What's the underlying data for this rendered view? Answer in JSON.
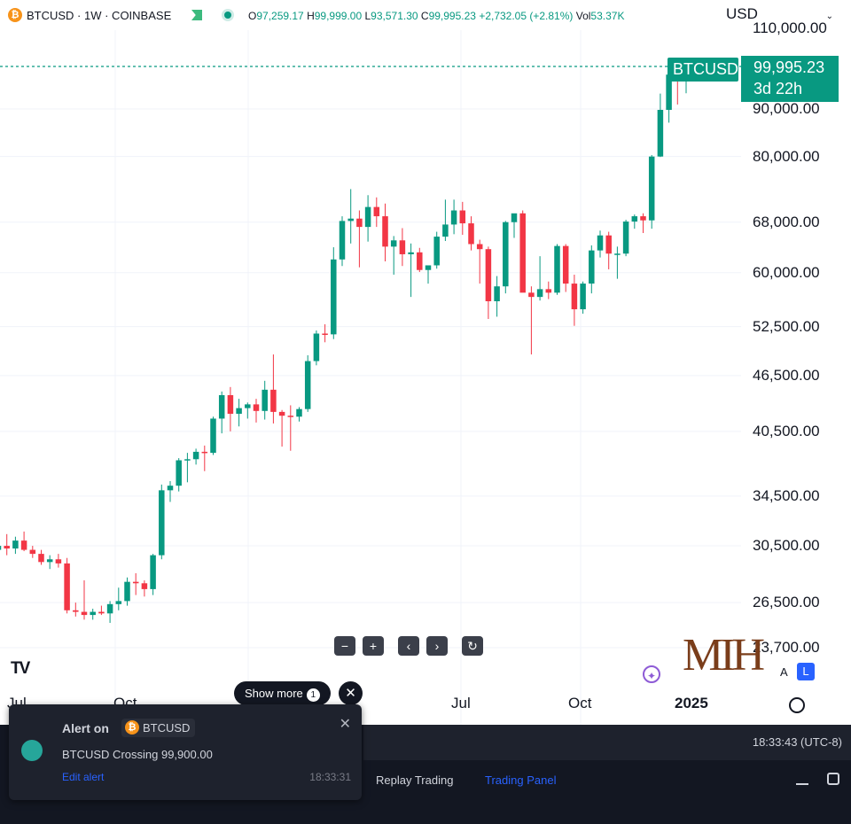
{
  "header": {
    "symbol_line": "BTCUSD · 1W · COINBASE",
    "ohlc": {
      "o_label": "O",
      "o": "97,259.17",
      "h_label": "H",
      "h": "99,999.00",
      "l_label": "L",
      "l": "93,571.30",
      "c_label": "C",
      "c": "99,995.23",
      "change": "+2,732.05 (+2.81%)",
      "vol_label": "Vol",
      "vol": "53.37K"
    },
    "currency": "USD"
  },
  "price_tag": {
    "symbol": "BTCUSD",
    "price": "99,995.23",
    "countdown": "3d 22h"
  },
  "controls": {
    "show_more": "Show more",
    "show_more_count": "1",
    "auto_label": "A",
    "log_label": "L"
  },
  "watermark": "MIH",
  "bottom": {
    "time": "18:33:43 (UTC-8)",
    "tab_replay": "Replay Trading",
    "tab_trading_panel": "Trading Panel"
  },
  "alert": {
    "title": "Alert on",
    "symbol": "BTCUSD",
    "message": "BTCUSD Crossing 99,900.00",
    "edit": "Edit alert",
    "time": "18:33:31"
  },
  "colors": {
    "up": "#089981",
    "down": "#f23645",
    "accent": "#2962ff"
  },
  "chart_data": {
    "type": "candlestick",
    "symbol": "BTCUSD",
    "interval": "1W",
    "y_ticks": [
      "23,700.00",
      "26,500.00",
      "30,500.00",
      "34,500.00",
      "40,500.00",
      "46,500.00",
      "52,500.00",
      "60,000.00",
      "68,000.00",
      "80,000.00",
      "90,000.00",
      "110,000.00"
    ],
    "y_tick_values": [
      23700,
      26500,
      30500,
      34500,
      40500,
      46500,
      52500,
      60000,
      68000,
      80000,
      90000,
      110000
    ],
    "x_ticks": [
      "Jul",
      "Oct",
      "Jul",
      "Oct",
      "2025"
    ],
    "y_scale": "log",
    "last_price": 99995.23,
    "candles": [
      {
        "o": 30200,
        "h": 31800,
        "l": 29800,
        "c": 30500
      },
      {
        "o": 30500,
        "h": 31400,
        "l": 29800,
        "c": 30300
      },
      {
        "o": 30300,
        "h": 31200,
        "l": 29900,
        "c": 30900
      },
      {
        "o": 30900,
        "h": 31600,
        "l": 30100,
        "c": 30200
      },
      {
        "o": 30200,
        "h": 30500,
        "l": 29600,
        "c": 29900
      },
      {
        "o": 29900,
        "h": 30200,
        "l": 29100,
        "c": 29300
      },
      {
        "o": 29300,
        "h": 29800,
        "l": 28800,
        "c": 29500
      },
      {
        "o": 29500,
        "h": 29900,
        "l": 28900,
        "c": 29200
      },
      {
        "o": 29200,
        "h": 29600,
        "l": 25800,
        "c": 26000
      },
      {
        "o": 26000,
        "h": 26500,
        "l": 25600,
        "c": 25900
      },
      {
        "o": 25900,
        "h": 28000,
        "l": 25400,
        "c": 25700
      },
      {
        "o": 25700,
        "h": 26100,
        "l": 25400,
        "c": 25900
      },
      {
        "o": 25900,
        "h": 26300,
        "l": 25700,
        "c": 25800
      },
      {
        "o": 25800,
        "h": 26600,
        "l": 25200,
        "c": 26400
      },
      {
        "o": 26400,
        "h": 27500,
        "l": 26000,
        "c": 26600
      },
      {
        "o": 26600,
        "h": 28200,
        "l": 26300,
        "c": 27900
      },
      {
        "o": 27900,
        "h": 28500,
        "l": 27000,
        "c": 27800
      },
      {
        "o": 27800,
        "h": 28000,
        "l": 26900,
        "c": 27400
      },
      {
        "o": 27400,
        "h": 29900,
        "l": 27000,
        "c": 29800
      },
      {
        "o": 29800,
        "h": 35500,
        "l": 29500,
        "c": 35000
      },
      {
        "o": 35000,
        "h": 35800,
        "l": 34000,
        "c": 35400
      },
      {
        "o": 35400,
        "h": 37900,
        "l": 34900,
        "c": 37700
      },
      {
        "o": 37700,
        "h": 38400,
        "l": 35700,
        "c": 37800
      },
      {
        "o": 37800,
        "h": 38800,
        "l": 37300,
        "c": 38500
      },
      {
        "o": 38500,
        "h": 39100,
        "l": 36700,
        "c": 38400
      },
      {
        "o": 38400,
        "h": 42000,
        "l": 38200,
        "c": 41800
      },
      {
        "o": 41800,
        "h": 44700,
        "l": 40300,
        "c": 44300
      },
      {
        "o": 44300,
        "h": 45200,
        "l": 40500,
        "c": 42300
      },
      {
        "o": 42300,
        "h": 43900,
        "l": 41000,
        "c": 42900
      },
      {
        "o": 42900,
        "h": 43500,
        "l": 41800,
        "c": 43300
      },
      {
        "o": 43300,
        "h": 43900,
        "l": 41400,
        "c": 42600
      },
      {
        "o": 42600,
        "h": 45900,
        "l": 41700,
        "c": 44900
      },
      {
        "o": 44900,
        "h": 49000,
        "l": 41300,
        "c": 42500
      },
      {
        "o": 42500,
        "h": 42700,
        "l": 39000,
        "c": 42100
      },
      {
        "o": 42100,
        "h": 43200,
        "l": 38600,
        "c": 42000
      },
      {
        "o": 42000,
        "h": 43000,
        "l": 41500,
        "c": 42800
      },
      {
        "o": 42800,
        "h": 48900,
        "l": 42500,
        "c": 48200
      },
      {
        "o": 48200,
        "h": 52000,
        "l": 47700,
        "c": 51600
      },
      {
        "o": 51600,
        "h": 52800,
        "l": 50500,
        "c": 51500
      },
      {
        "o": 51500,
        "h": 63900,
        "l": 50900,
        "c": 62000
      },
      {
        "o": 62000,
        "h": 69000,
        "l": 61000,
        "c": 68200
      },
      {
        "o": 68200,
        "h": 73800,
        "l": 64500,
        "c": 68600
      },
      {
        "o": 68600,
        "h": 70000,
        "l": 60800,
        "c": 67200
      },
      {
        "o": 67200,
        "h": 72700,
        "l": 64800,
        "c": 70600
      },
      {
        "o": 70600,
        "h": 72300,
        "l": 67200,
        "c": 69000
      },
      {
        "o": 69000,
        "h": 71200,
        "l": 61700,
        "c": 64000
      },
      {
        "o": 64000,
        "h": 65700,
        "l": 59700,
        "c": 65000
      },
      {
        "o": 65000,
        "h": 67000,
        "l": 61000,
        "c": 62800
      },
      {
        "o": 62800,
        "h": 64500,
        "l": 56500,
        "c": 63100
      },
      {
        "o": 63100,
        "h": 63800,
        "l": 60100,
        "c": 60400
      },
      {
        "o": 60400,
        "h": 61000,
        "l": 58400,
        "c": 61100
      },
      {
        "o": 61100,
        "h": 66400,
        "l": 60600,
        "c": 65600
      },
      {
        "o": 65600,
        "h": 71900,
        "l": 64900,
        "c": 67600
      },
      {
        "o": 67600,
        "h": 71900,
        "l": 66000,
        "c": 70000
      },
      {
        "o": 70000,
        "h": 71500,
        "l": 65900,
        "c": 67800
      },
      {
        "o": 67800,
        "h": 69000,
        "l": 63400,
        "c": 64400
      },
      {
        "o": 64400,
        "h": 65100,
        "l": 58400,
        "c": 63600
      },
      {
        "o": 63600,
        "h": 64000,
        "l": 53500,
        "c": 55900
      },
      {
        "o": 55900,
        "h": 59500,
        "l": 53800,
        "c": 58000
      },
      {
        "o": 58000,
        "h": 68200,
        "l": 57000,
        "c": 68000
      },
      {
        "o": 68000,
        "h": 69400,
        "l": 65400,
        "c": 69500
      },
      {
        "o": 69500,
        "h": 70000,
        "l": 61000,
        "c": 57100
      },
      {
        "o": 57100,
        "h": 58000,
        "l": 49000,
        "c": 56500
      },
      {
        "o": 56500,
        "h": 62500,
        "l": 56000,
        "c": 57600
      },
      {
        "o": 57600,
        "h": 58700,
        "l": 56200,
        "c": 57100
      },
      {
        "o": 57100,
        "h": 64400,
        "l": 56800,
        "c": 64100
      },
      {
        "o": 64100,
        "h": 64400,
        "l": 57200,
        "c": 58400
      },
      {
        "o": 58400,
        "h": 59700,
        "l": 52600,
        "c": 54800
      },
      {
        "o": 54800,
        "h": 58700,
        "l": 54200,
        "c": 58400
      },
      {
        "o": 58400,
        "h": 64200,
        "l": 57000,
        "c": 63400
      },
      {
        "o": 63400,
        "h": 66600,
        "l": 62300,
        "c": 65800
      },
      {
        "o": 65800,
        "h": 66400,
        "l": 60500,
        "c": 62900
      },
      {
        "o": 62900,
        "h": 64000,
        "l": 59100,
        "c": 62900
      },
      {
        "o": 62900,
        "h": 68400,
        "l": 62500,
        "c": 68100
      },
      {
        "o": 68100,
        "h": 69300,
        "l": 66900,
        "c": 69000
      },
      {
        "o": 69000,
        "h": 69500,
        "l": 66200,
        "c": 68300
      },
      {
        "o": 68300,
        "h": 80300,
        "l": 66900,
        "c": 80000
      },
      {
        "o": 80000,
        "h": 93500,
        "l": 79900,
        "c": 89800
      },
      {
        "o": 89800,
        "h": 99000,
        "l": 87000,
        "c": 98000
      },
      {
        "o": 98000,
        "h": 99800,
        "l": 91000,
        "c": 97260
      },
      {
        "o": 97260,
        "h": 99999,
        "l": 93571,
        "c": 99995
      }
    ]
  }
}
